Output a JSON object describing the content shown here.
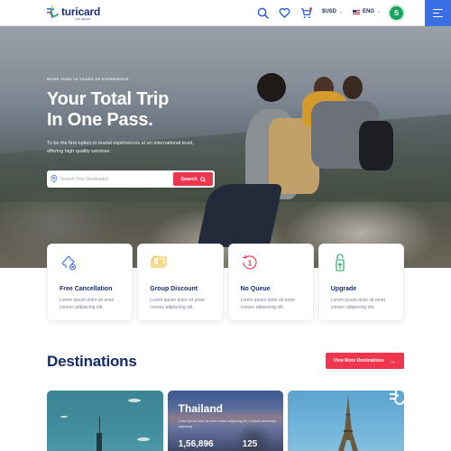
{
  "header": {
    "logo_text": "turicard",
    "logo_tagline": "Your total trip",
    "currency": "$USD",
    "language": "ENG",
    "avatar_initial": "S",
    "icons": [
      "search-icon",
      "heart-icon",
      "cart-icon",
      "chevron-down-icon",
      "flag-us-icon",
      "menu-icon"
    ]
  },
  "hero": {
    "eyebrow": "MORE THAN 15 YEARS OF EXPERIENCE",
    "title_line1": "Your Total Trip",
    "title_line2": "In One Pass.",
    "description": "To be the first option in tourist experiences at an international level, offering high quality services.",
    "search": {
      "placeholder": "Search Your Destination",
      "value": "",
      "button_label": "Search"
    }
  },
  "features": [
    {
      "icon": "ticket-cancel-icon",
      "title": "Free Cancellation",
      "description": "Lorem ipsum dolor sit amet consec adipiscing elit."
    },
    {
      "icon": "discount-card-icon",
      "title": "Group Discount",
      "description": "Lorem ipsum dolor sit amet consec adipiscing elit."
    },
    {
      "icon": "queue-counter-icon",
      "title": "No Queue",
      "description": "Lorem ipsum dolor sit amet consec adipiscing elit."
    },
    {
      "icon": "upgrade-tag-icon",
      "title": "Upgrade",
      "description": "Lorem ipsum dolor sit amet consec adipiscing elit."
    }
  ],
  "destinations": {
    "title": "Destinations",
    "view_more_label": "View More Destinations",
    "cards": [
      {
        "name": "",
        "scene": "new-york-skyline"
      },
      {
        "name": "Thailand",
        "description": "Lorem ipsum dolor sit amet consec adipiscing elit, in turpis elementum adipiscing.",
        "stat1": "1,56,896",
        "stat2": "125",
        "scene": "thailand-cliffs"
      },
      {
        "name": "",
        "scene": "paris-eiffel-tower"
      }
    ]
  },
  "colors": {
    "accent_red": "#f0354e",
    "brand_blue": "#3b6fe8",
    "navy": "#132a6b",
    "avatar_green": "#1aa260"
  }
}
